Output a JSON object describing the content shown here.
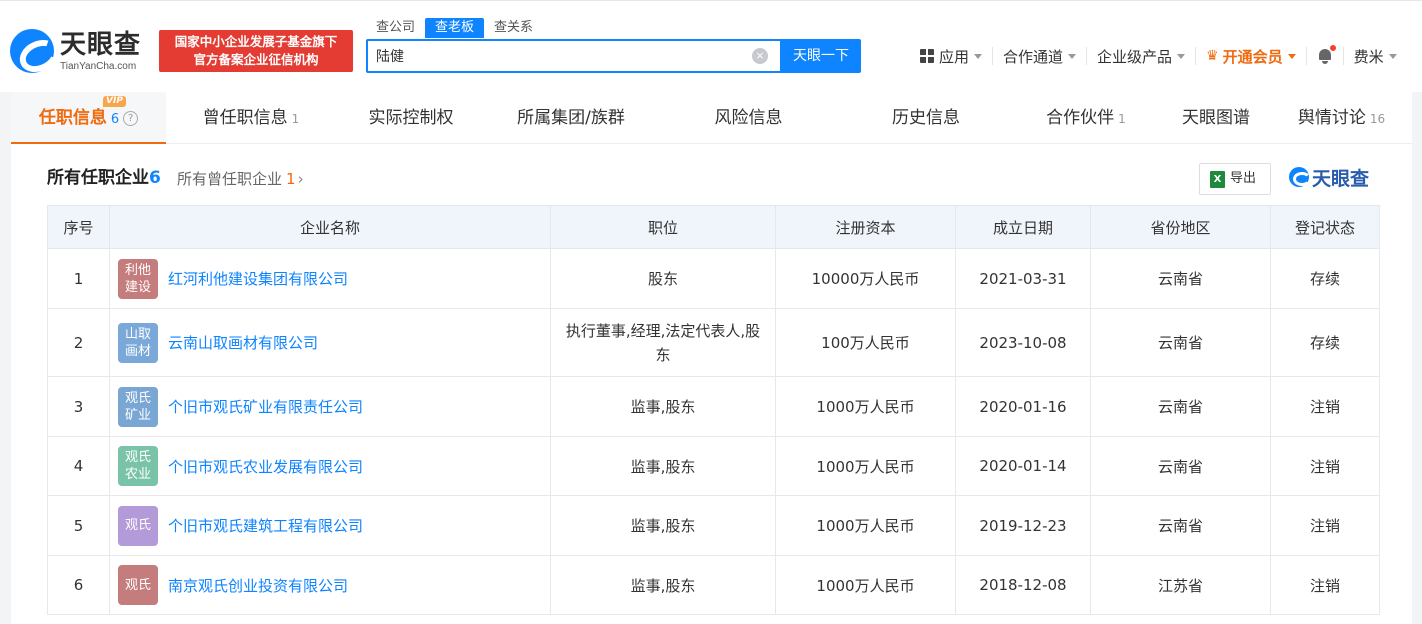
{
  "header": {
    "logo_text": "天眼查",
    "logo_sub": "TianYanCha.com",
    "banner_line1": "国家中小企业发展子基金旗下",
    "banner_line2": "官方备案企业征信机构",
    "search_tabs": [
      "查公司",
      "查老板",
      "查关系"
    ],
    "search_value": "陆健",
    "clear_icon": "×",
    "search_button": "天眼一下",
    "nav": {
      "apps": "应用",
      "channel": "合作通道",
      "enterprise": "企业级产品",
      "vip": "开通会员",
      "user": "费米"
    }
  },
  "tabs": [
    {
      "label": "任职信息",
      "count": "6",
      "active": true,
      "vip": "VIP"
    },
    {
      "label": "曾任职信息",
      "count": "1"
    },
    {
      "label": "实际控制权",
      "count": ""
    },
    {
      "label": "所属集团/族群",
      "count": ""
    },
    {
      "label": "风险信息",
      "count": ""
    },
    {
      "label": "历史信息",
      "count": ""
    },
    {
      "label": "合作伙伴",
      "count": "1"
    },
    {
      "label": "天眼图谱",
      "count": ""
    },
    {
      "label": "舆情讨论",
      "count": "16"
    }
  ],
  "section": {
    "title": "所有任职企业",
    "title_count": "6",
    "sub": "所有曾任职企业",
    "sub_count": "1",
    "export": "导出",
    "brand": "天眼查"
  },
  "table": {
    "columns": [
      "序号",
      "企业名称",
      "职位",
      "注册资本",
      "成立日期",
      "省份地区",
      "登记状态"
    ],
    "rows": [
      {
        "no": "1",
        "badge": [
          "利他",
          "建设"
        ],
        "badge_color": "#c47c7c",
        "name": "红河利他建设集团有限公司",
        "position": "股东",
        "capital": "10000万人民币",
        "date": "2021-03-31",
        "region": "云南省",
        "status": "存续",
        "status_type": "ok"
      },
      {
        "no": "2",
        "badge": [
          "山取",
          "画材"
        ],
        "badge_color": "#7aa8d8",
        "name": "云南山取画材有限公司",
        "position": "执行董事,经理,法定代表人,股东",
        "capital": "100万人民币",
        "date": "2023-10-08",
        "region": "云南省",
        "status": "存续",
        "status_type": "ok"
      },
      {
        "no": "3",
        "badge": [
          "观氏",
          "矿业"
        ],
        "badge_color": "#79a6d2",
        "name": "个旧市观氏矿业有限责任公司",
        "position": "监事,股东",
        "capital": "1000万人民币",
        "date": "2020-01-16",
        "region": "云南省",
        "status": "注销",
        "status_type": "bad"
      },
      {
        "no": "4",
        "badge": [
          "观氏",
          "农业"
        ],
        "badge_color": "#79c3a8",
        "name": "个旧市观氏农业发展有限公司",
        "position": "监事,股东",
        "capital": "1000万人民币",
        "date": "2020-01-14",
        "region": "云南省",
        "status": "注销",
        "status_type": "bad"
      },
      {
        "no": "5",
        "badge": [
          "观氏"
        ],
        "badge_color": "#b39ad8",
        "name": "个旧市观氏建筑工程有限公司",
        "position": "监事,股东",
        "capital": "1000万人民币",
        "date": "2019-12-23",
        "region": "云南省",
        "status": "注销",
        "status_type": "bad"
      },
      {
        "no": "6",
        "badge": [
          "观氏"
        ],
        "badge_color": "#c47c7c",
        "name": "南京观氏创业投资有限公司",
        "position": "监事,股东",
        "capital": "1000万人民币",
        "date": "2018-12-08",
        "region": "江苏省",
        "status": "注销",
        "status_type": "bad"
      }
    ]
  }
}
